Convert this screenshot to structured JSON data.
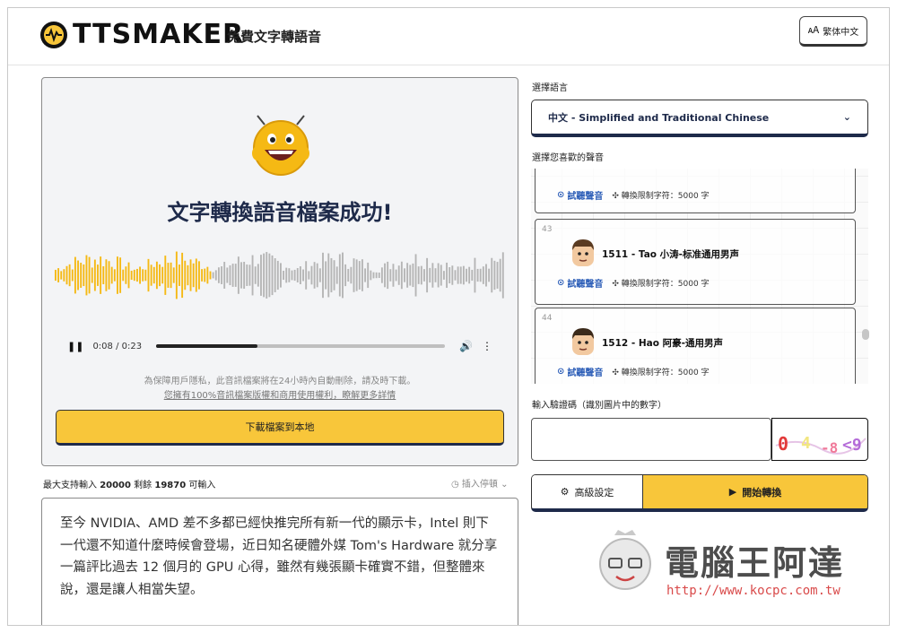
{
  "header": {
    "logo_text": "TTSMAKER",
    "tagline": "免費文字轉語音",
    "language_button": "繁体中文"
  },
  "result": {
    "title": "文字轉換語音檔案成功!",
    "current_time": "0:08",
    "duration": "0:23",
    "progress_fraction": 0.35,
    "notice": "為保障用戶隱私，此音訊檔案將在24小時內自動刪除，請及時下載。",
    "license_link": "您擁有100%音訊檔案版權和商用使用權利，瞭解更多詳情",
    "download_button": "下載檔案到本地"
  },
  "input": {
    "count_prefix": "最大支持輸入",
    "max_chars": "20000",
    "remaining_label": "剩餘",
    "remaining": "19870",
    "count_suffix": "可輸入",
    "insert_pause": "插入停頓",
    "text": "至今 NVIDIA、AMD 差不多都已經快推完所有新一代的顯示卡，Intel 則下一代還不知道什麼時候會登場，近日知名硬體外媒 Tom's Hardware 就分享一篇評比過去 12 個月的 GPU 心得，雖然有幾張顯卡確實不錯，但整體來說，還是讓人相當失望。"
  },
  "language": {
    "label": "選擇語言",
    "selected": "中文 - Simplified and Traditional Chinese"
  },
  "voices": {
    "label": "選擇您喜歡的聲音",
    "items": [
      {
        "num": "",
        "name": "",
        "listen": "試聽聲音",
        "limit": "轉換限制字符：5000 字"
      },
      {
        "num": "43",
        "name": "1511 - Tao 小涛-标准通用男声",
        "listen": "試聽聲音",
        "limit": "轉換限制字符：5000 字"
      },
      {
        "num": "44",
        "name": "1512 - Hao 阿豪-通用男声",
        "listen": "試聽聲音",
        "limit": "轉換限制字符：5000 字"
      }
    ]
  },
  "captcha": {
    "label": "輸入驗證碼（識別圖片中的數字）",
    "chars": "0 4 8 9"
  },
  "actions": {
    "advanced": "高級設定",
    "start": "開始轉換"
  },
  "watermark": {
    "title": "電腦王阿達",
    "url": "http://www.kocpc.com.tw"
  },
  "colors": {
    "accent_yellow": "#f8c63a",
    "navy": "#1e2a4a",
    "link_blue": "#2e5fb8",
    "wave_played": "#f5b914",
    "wave_unplayed": "#b5b5b5"
  }
}
